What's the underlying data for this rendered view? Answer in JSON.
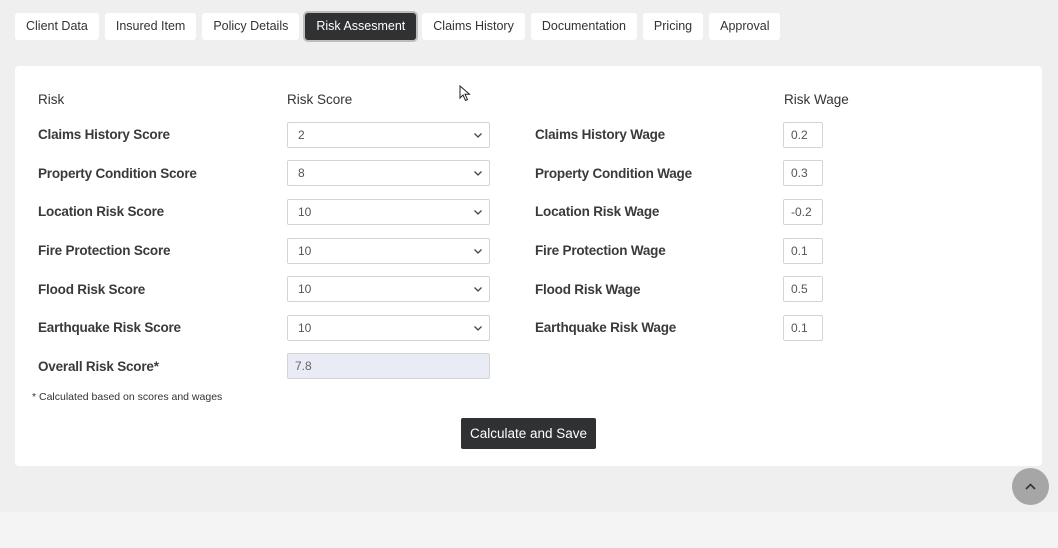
{
  "tabs": [
    {
      "label": "Client Data"
    },
    {
      "label": "Insured Item"
    },
    {
      "label": "Policy Details"
    },
    {
      "label": "Risk Assesment"
    },
    {
      "label": "Claims History"
    },
    {
      "label": "Documentation"
    },
    {
      "label": "Pricing"
    },
    {
      "label": "Approval"
    }
  ],
  "active_tab": "Risk Assesment",
  "headers": {
    "risk": "Risk",
    "score": "Risk Score",
    "wage": "Risk Wage"
  },
  "rows": [
    {
      "label": "Claims History Score",
      "score": "2",
      "wage_label": "Claims History Wage",
      "wage": "0.2"
    },
    {
      "label": "Property Condition Score",
      "score": "8",
      "wage_label": "Property Condition Wage",
      "wage": "0.3"
    },
    {
      "label": "Location Risk Score",
      "score": "10",
      "wage_label": "Location Risk Wage",
      "wage": "-0.2"
    },
    {
      "label": "Fire Protection Score",
      "score": "10",
      "wage_label": "Fire Protection Wage",
      "wage": "0.1"
    },
    {
      "label": "Flood Risk Score",
      "score": "10",
      "wage_label": "Flood Risk Wage",
      "wage": "0.5"
    },
    {
      "label": "Earthquake Risk Score",
      "score": "10",
      "wage_label": "Earthquake Risk Wage",
      "wage": "0.1"
    }
  ],
  "overall": {
    "label": "Overall Risk Score*",
    "value": "7.8"
  },
  "note": "* Calculated based on scores and wages",
  "calculate_button": "Calculate and Save",
  "icons": {
    "select_arrow": "chevron-down-icon",
    "scroll_top": "chevron-up-icon",
    "cursor": "mouse-pointer-icon"
  },
  "colors": {
    "active_tab_bg": "#2f3133",
    "page_bg": "#efefef",
    "readonly_bg": "#e9ebf5",
    "scroll_top_bg": "#a6a6a6"
  }
}
